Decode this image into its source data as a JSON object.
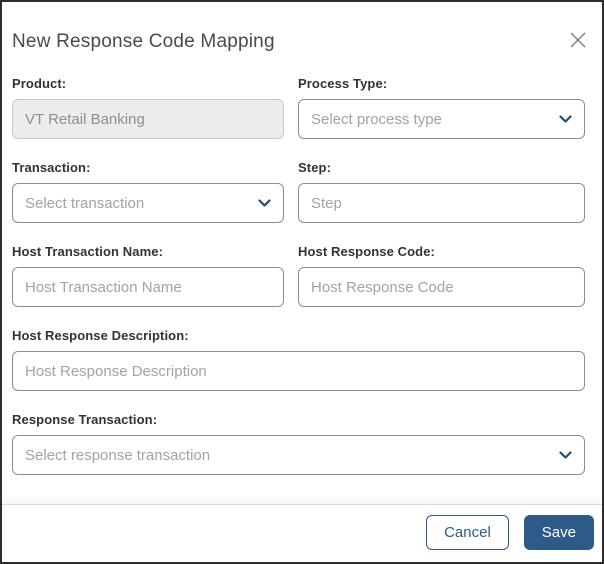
{
  "dialog": {
    "title": "New Response Code Mapping"
  },
  "fields": {
    "product": {
      "label": "Product:",
      "value": "VT Retail Banking",
      "state": "disabled"
    },
    "process_type": {
      "label": "Process Type:",
      "placeholder": "Select process type"
    },
    "transaction": {
      "label": "Transaction:",
      "placeholder": "Select transaction"
    },
    "step": {
      "label": "Step:",
      "placeholder": "Step"
    },
    "host_transaction_name": {
      "label": "Host Transaction Name:",
      "placeholder": "Host Transaction Name"
    },
    "host_response_code": {
      "label": "Host Response Code:",
      "placeholder": "Host Response Code"
    },
    "host_response_description": {
      "label": "Host Response Description:",
      "placeholder": "Host Response Description"
    },
    "response_transaction": {
      "label": "Response Transaction:",
      "placeholder": "Select response transaction"
    }
  },
  "footer": {
    "cancel_label": "Cancel",
    "save_label": "Save"
  },
  "icons": {
    "close": "diagonal-cross",
    "chevron_down": "v-shape"
  },
  "colors": {
    "accent": "#2e5a87",
    "chevron": "#1f4e79",
    "dialog_border": "#2e2e2e",
    "input_border": "#8e8e8e",
    "disabled_bg": "#ececec",
    "label_text": "#333333",
    "placeholder_text": "#a3a3a3",
    "title_text": "#4a4a4a"
  }
}
